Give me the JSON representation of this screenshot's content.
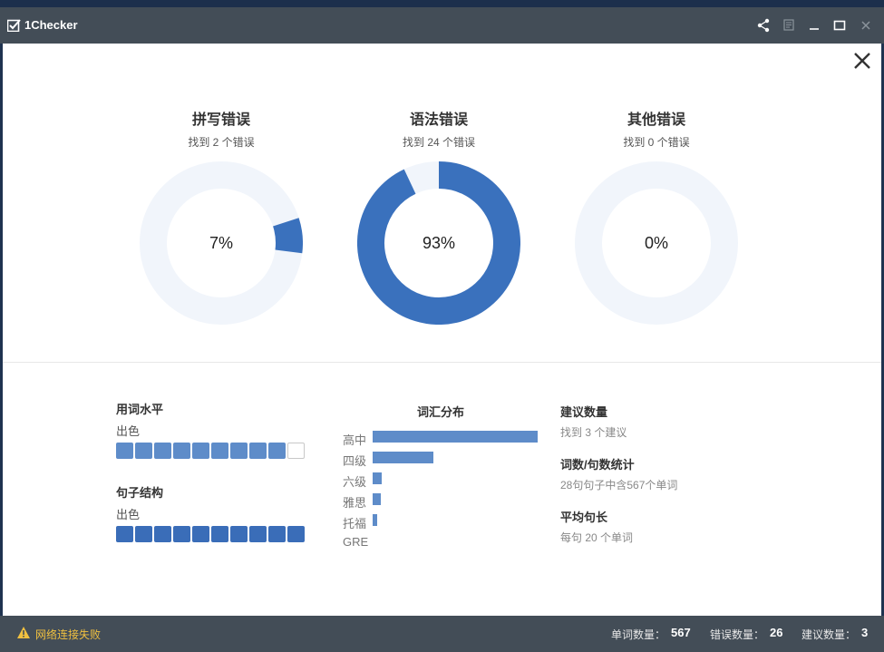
{
  "window": {
    "title": "1Checker"
  },
  "gauges": [
    {
      "title": "拼写错误",
      "subtitle": "找到 2 个错误",
      "percent_label": "7%",
      "fraction": 0.07,
      "start_fraction": 0.2
    },
    {
      "title": "语法错误",
      "subtitle": "找到 24 个错误",
      "percent_label": "93%",
      "fraction": 0.93,
      "start_fraction": 0.0
    },
    {
      "title": "其他错误",
      "subtitle": "找到 0 个错误",
      "percent_label": "0%",
      "fraction": 0.0,
      "start_fraction": 0.0
    }
  ],
  "colors": {
    "accent": "#3a71bd",
    "track": "#f1f5fb",
    "bar": "#5e8cc9",
    "warning": "#f0c040",
    "titlebar": "#434d57"
  },
  "word_level": {
    "heading": "用词水平",
    "value": "出色",
    "filled": 9,
    "total": 10
  },
  "sentence_structure": {
    "heading": "句子结构",
    "value": "出色",
    "filled": 10,
    "total": 10
  },
  "vocab": {
    "title": "词汇分布",
    "items": [
      {
        "label": "高中",
        "fraction": 1.0
      },
      {
        "label": "四级",
        "fraction": 0.37
      },
      {
        "label": "六级",
        "fraction": 0.055
      },
      {
        "label": "雅思",
        "fraction": 0.05
      },
      {
        "label": "托福",
        "fraction": 0.028
      },
      {
        "label": "GRE",
        "fraction": 0.0
      }
    ]
  },
  "stats": {
    "suggestions_heading": "建议数量",
    "suggestions_value": "找到 3 个建议",
    "counts_heading": "词数/句数统计",
    "counts_value": "28句句子中含567个单词",
    "avg_heading": "平均句长",
    "avg_value": "每句 20 个单词"
  },
  "statusbar": {
    "warning": "网络连接失败",
    "word_count_label": "单词数量：",
    "word_count": "567",
    "error_count_label": "错误数量：",
    "error_count": "26",
    "suggestion_count_label": "建议数量：",
    "suggestion_count": "3"
  },
  "icons": {
    "logo": "checkbox-logo-icon",
    "share": "share-icon",
    "notes": "notes-icon",
    "minimize": "minimize-icon",
    "maximize": "maximize-icon",
    "window_close": "window-close-icon",
    "panel_close": "close-icon",
    "warning": "warning-icon"
  }
}
